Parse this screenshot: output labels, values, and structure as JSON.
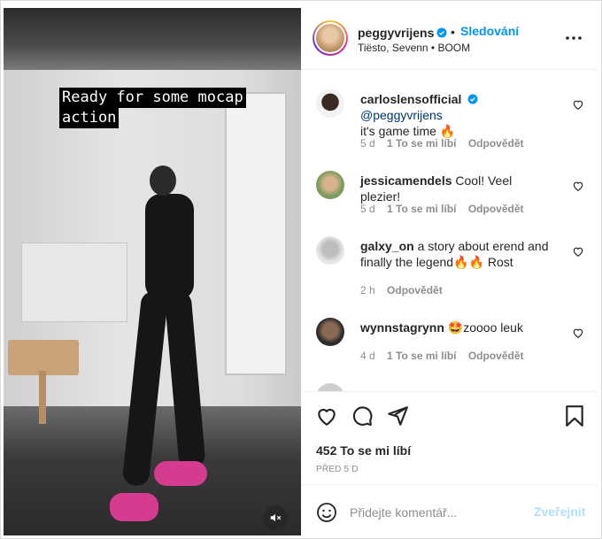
{
  "post": {
    "caption_lines": [
      "Ready for some mocap",
      "action"
    ],
    "mute_icon": "speaker-muted-icon"
  },
  "header": {
    "username": "peggyvrijens",
    "follow_label": "Sledování",
    "music": "Tiësto, Sevenn • BOOM",
    "more_icon": "more-horizontal-icon"
  },
  "comments": [
    {
      "user": "carloslensofficial",
      "verified": true,
      "mention": "@peggyvrijens",
      "text": "it's game time 🔥",
      "age": "5 d",
      "likes": "1 To se mi líbí",
      "reply": "Odpovědět"
    },
    {
      "user": "jessicamendels",
      "text": "Cool! Veel plezier!",
      "age": "5 d",
      "likes": "1 To se mi líbí",
      "reply": "Odpovědět"
    },
    {
      "user": "galxy_on",
      "text": "a story about erend and finally the legend🔥🔥 Rost",
      "age": "2 h",
      "reply": "Odpovědět"
    },
    {
      "user": "wynnstagrynn",
      "text": "🤩zoooo leuk",
      "age": "4 d",
      "likes": "1 To se mi líbí",
      "reply": "Odpovědět"
    }
  ],
  "actions": {
    "likes": "452 To se mi líbí",
    "time": "PŘED 5 D"
  },
  "add_comment": {
    "placeholder": "Přidejte komentář...",
    "post_label": "Zveřejnit"
  },
  "colors": {
    "accent": "#0095f6",
    "post_disabled": "#b2dffc",
    "muted_text": "#8e8e8e"
  }
}
